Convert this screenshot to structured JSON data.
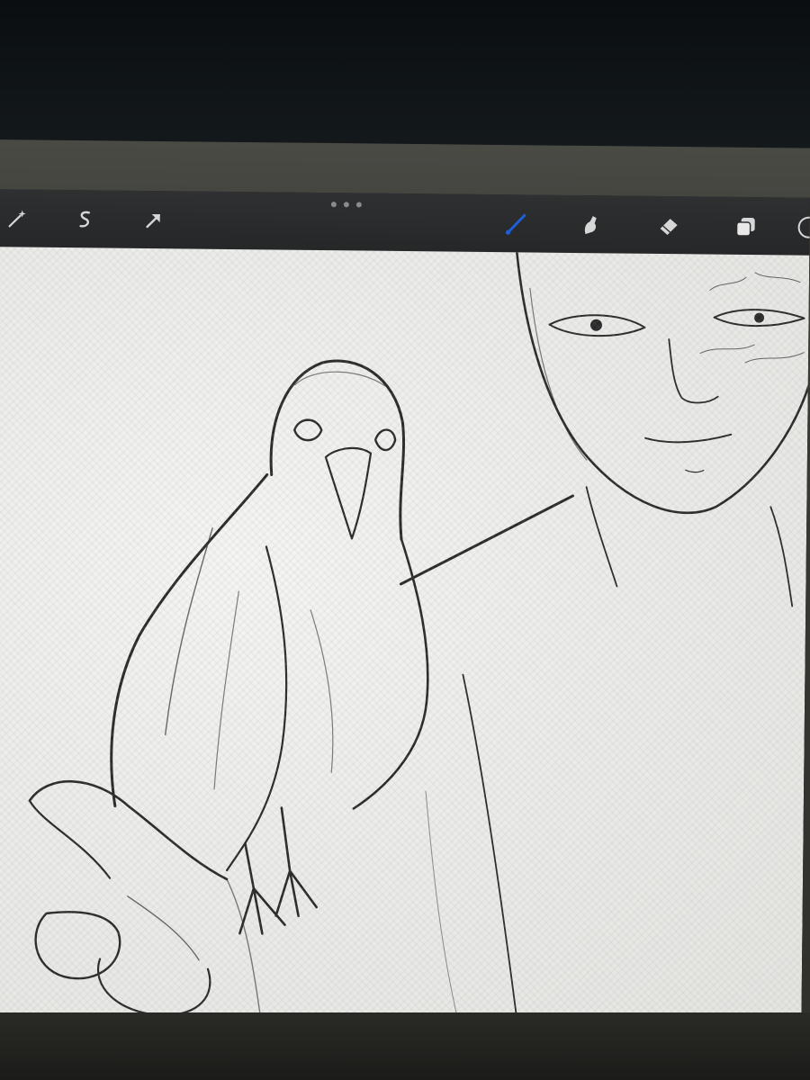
{
  "app": {
    "toolbar": {
      "left_tools": [
        {
          "name": "adjustments-icon",
          "label": ""
        },
        {
          "name": "selection-icon",
          "label": ""
        },
        {
          "name": "transform-icon",
          "label": ""
        }
      ],
      "more_menu": "more-options",
      "right_tools": [
        {
          "name": "brush-icon",
          "active": true
        },
        {
          "name": "smudge-icon",
          "active": false
        },
        {
          "name": "eraser-icon",
          "active": false
        },
        {
          "name": "layers-icon",
          "active": false
        }
      ],
      "active_color": "#1f5fd6"
    },
    "canvas": {
      "content": "pencil sketch"
    }
  }
}
